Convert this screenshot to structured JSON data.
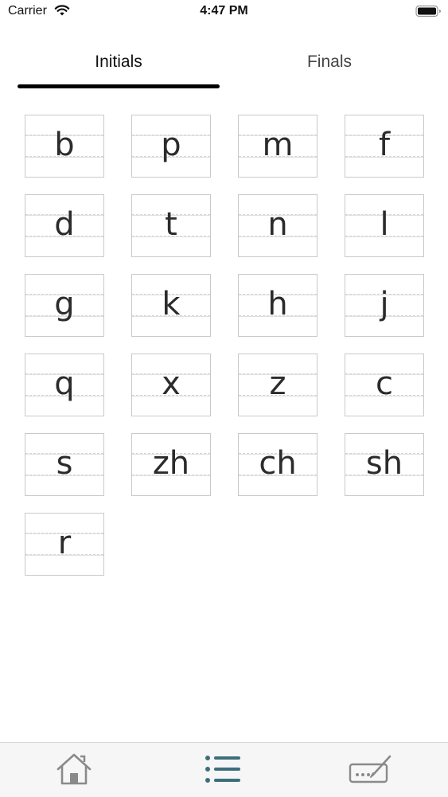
{
  "status_bar": {
    "carrier": "Carrier",
    "time": "4:47 PM",
    "wifi_icon": "wifi-icon",
    "battery_icon": "battery-icon"
  },
  "tabs": [
    {
      "label": "Initials",
      "selected": true
    },
    {
      "label": "Finals",
      "selected": false
    }
  ],
  "initials": [
    "b",
    "p",
    "m",
    "f",
    "d",
    "t",
    "n",
    "l",
    "g",
    "k",
    "h",
    "j",
    "q",
    "x",
    "z",
    "c",
    "s",
    "zh",
    "ch",
    "sh",
    "r"
  ],
  "bottom_bar": {
    "items": [
      {
        "icon": "home-icon",
        "selected": false
      },
      {
        "icon": "list-icon",
        "selected": true
      },
      {
        "icon": "write-icon",
        "selected": false
      }
    ],
    "colors": {
      "selected": "#3d6e7c",
      "unselected": "#8a8a8a"
    }
  }
}
